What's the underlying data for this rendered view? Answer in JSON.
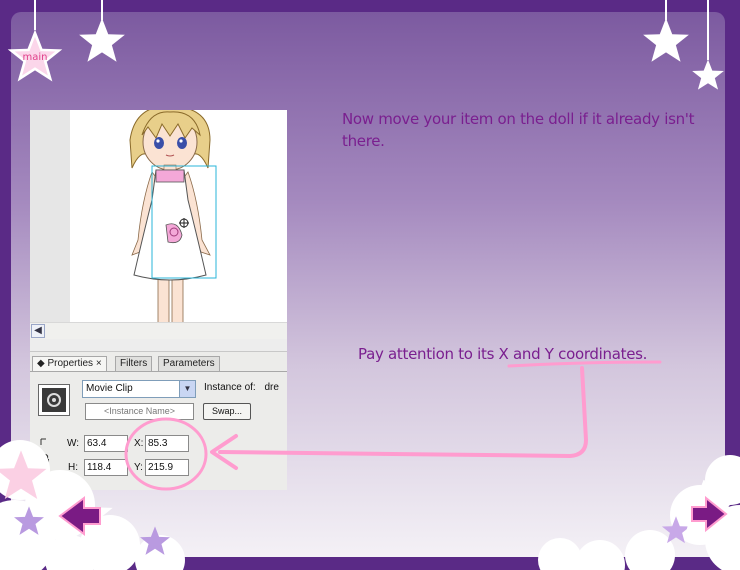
{
  "nav": {
    "main_label": "main",
    "back_icon": "left-arrow-icon",
    "next_icon": "right-arrow-icon"
  },
  "instructions": {
    "step_text": "Now move your item on the doll if it already isn't there.",
    "coords_text": "Pay attention to its X and Y coordinates."
  },
  "properties_panel": {
    "tabs": [
      {
        "label": "Properties",
        "close": "×"
      },
      {
        "label": "Filters"
      },
      {
        "label": "Parameters"
      }
    ],
    "symbol_type": "Movie Clip",
    "instance_of_label": "Instance of:",
    "instance_of_value": "dre",
    "instance_name_placeholder": "<Instance Name>",
    "swap_label": "Swap...",
    "w_label": "W:",
    "w_value": "63.4",
    "h_label": "H:",
    "h_value": "118.4",
    "x_label": "X:",
    "x_value": "85.3",
    "y_label": "Y:",
    "y_value": "215.9"
  },
  "colors": {
    "frame": "#5a2a86",
    "instruction_text": "#7a1f8f",
    "annotation_pink": "#ff9ccf",
    "badge_pink": "#e0408a",
    "arrow_purple": "#7a1b84"
  }
}
